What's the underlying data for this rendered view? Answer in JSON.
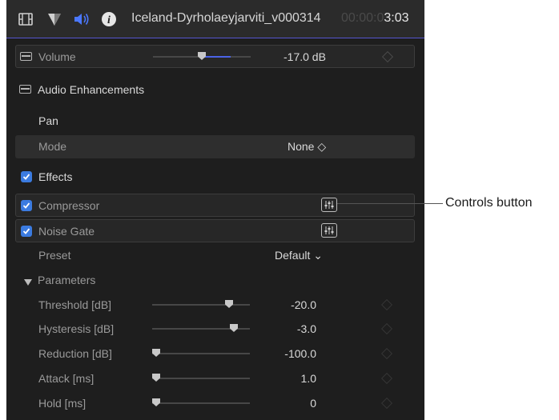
{
  "header": {
    "icons": [
      "film-icon",
      "filter-icon",
      "speaker-icon",
      "info-icon"
    ],
    "clip_name": "Iceland-Dyrholaeyjarviti_v000314",
    "timecode_dim": "00:00:0",
    "timecode_bright": "3:03"
  },
  "volume": {
    "label": "Volume",
    "value": "-17.0  dB",
    "level": 0.5
  },
  "audio_enhancements": {
    "label": "Audio Enhancements"
  },
  "pan": {
    "label": "Pan",
    "mode_label": "Mode",
    "mode_value": "None ◇"
  },
  "effects": {
    "label": "Effects",
    "items": [
      {
        "label": "Compressor",
        "checked": true
      },
      {
        "label": "Noise Gate",
        "checked": true
      }
    ]
  },
  "preset": {
    "label": "Preset",
    "value": "Default ⌄"
  },
  "parameters": {
    "label": "Parameters",
    "rows": [
      {
        "label": "Threshold [dB]",
        "value": "-20.0",
        "level": 0.8
      },
      {
        "label": "Hysteresis [dB]",
        "value": "-3.0",
        "level": 0.85
      },
      {
        "label": "Reduction [dB]",
        "value": "-100.0",
        "level": 0.0
      },
      {
        "label": "Attack [ms]",
        "value": "1.0",
        "level": 0.0
      },
      {
        "label": "Hold [ms]",
        "value": "0",
        "level": 0.0
      }
    ]
  },
  "callout": {
    "label": "Controls button"
  },
  "colors": {
    "accent": "#3b7be0",
    "panel": "#1e1e1e",
    "slider_fill": "#4b63e6"
  }
}
